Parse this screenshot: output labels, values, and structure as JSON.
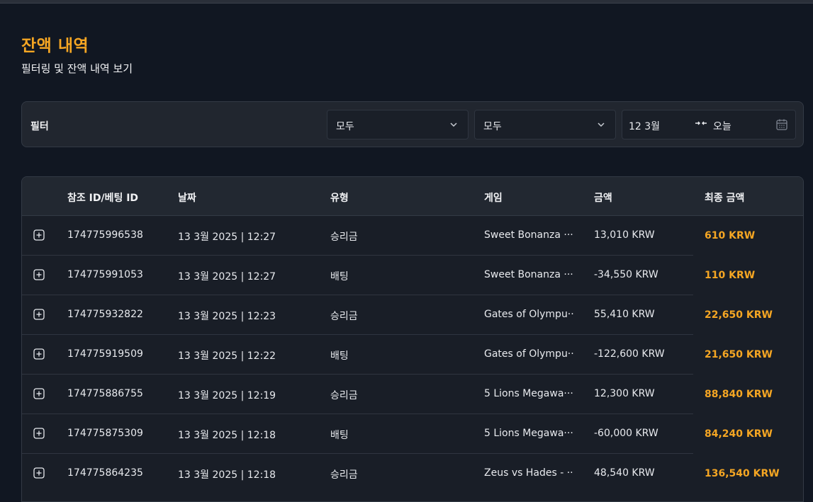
{
  "page": {
    "title": "잔액 내역",
    "subtitle": "필터링 및 잔액 내역 보기"
  },
  "filter": {
    "label": "필터",
    "select_type": "모두",
    "select_game": "모두",
    "date_start": "12 3월",
    "date_end": "오늘",
    "icons": [
      "chevron-down-icon",
      "arrows-right-left-icon",
      "calendar-icon"
    ]
  },
  "table": {
    "headers": [
      "참조 ID/베팅 ID",
      "날짜",
      "유형",
      "게임",
      "금액",
      "최종 금액"
    ],
    "expand_icon": "plus-square-icon",
    "accent_color": "#f5a623",
    "rows": [
      {
        "ref": "174775996538",
        "date": "13 3월 2025 | 12:27",
        "type": "승리금",
        "game": "Sweet Bonanza ···",
        "amount": "13,010 KRW",
        "final": "610 KRW"
      },
      {
        "ref": "174775991053",
        "date": "13 3월 2025 | 12:27",
        "type": "배팅",
        "game": "Sweet Bonanza ···",
        "amount": "-34,550 KRW",
        "final": "110 KRW"
      },
      {
        "ref": "174775932822",
        "date": "13 3월 2025 | 12:23",
        "type": "승리금",
        "game": "Gates of Olympu···",
        "amount": "55,410 KRW",
        "final": "22,650 KRW"
      },
      {
        "ref": "174775919509",
        "date": "13 3월 2025 | 12:22",
        "type": "배팅",
        "game": "Gates of Olympu···",
        "amount": "-122,600 KRW",
        "final": "21,650 KRW"
      },
      {
        "ref": "174775886755",
        "date": "13 3월 2025 | 12:19",
        "type": "승리금",
        "game": "5 Lions Megawa···",
        "amount": "12,300 KRW",
        "final": "88,840 KRW"
      },
      {
        "ref": "174775875309",
        "date": "13 3월 2025 | 12:18",
        "type": "배팅",
        "game": "5 Lions Megawa···",
        "amount": "-60,000 KRW",
        "final": "84,240 KRW"
      },
      {
        "ref": "174775864235",
        "date": "13 3월 2025 | 12:18",
        "type": "승리금",
        "game": "Zeus vs Hades - ···",
        "amount": "48,540 KRW",
        "final": "136,540 KRW"
      }
    ]
  }
}
